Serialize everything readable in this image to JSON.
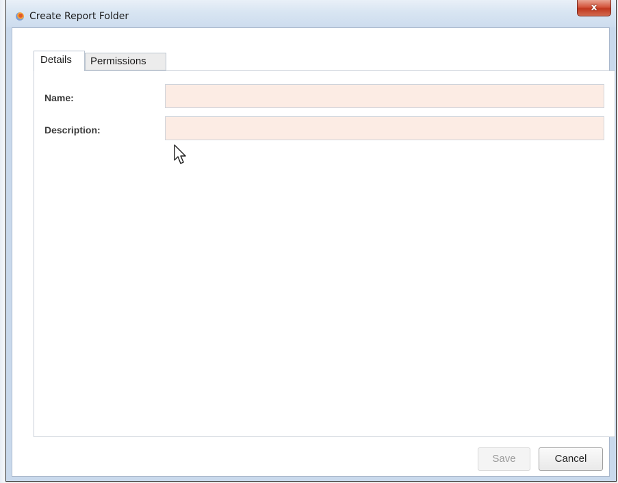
{
  "window": {
    "title": "Create Report Folder",
    "icon": "app-logo-icon",
    "close_label": "x"
  },
  "tabs": [
    {
      "label": "Details",
      "selected": true
    },
    {
      "label": "Permissions",
      "selected": false
    }
  ],
  "form": {
    "name_label": "Name:",
    "name_value": "",
    "description_label": "Description:",
    "description_value": ""
  },
  "buttons": {
    "save_label": "Save",
    "save_enabled": false,
    "cancel_label": "Cancel"
  },
  "colors": {
    "input_background": "#fcece4",
    "close_button": "#c0381f"
  }
}
